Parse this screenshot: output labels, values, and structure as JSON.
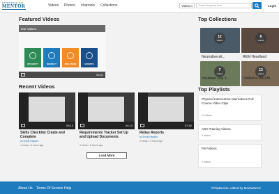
{
  "header": {
    "logo_small": "EXPERIENCE THE",
    "logo_main": "MENTOR",
    "nav": [
      "Videos",
      "Photos",
      "channels",
      "Collections"
    ],
    "scope_select": "Videos",
    "search_placeholder": "Search keyword here",
    "login": "Login"
  },
  "featured": {
    "heading": "Featured Videos",
    "title": "Our Values",
    "tiles": [
      {
        "label": "INTEGRITY",
        "color": "#2e8b57"
      },
      {
        "label": "RESPECT",
        "color": "#1e7bbd"
      },
      {
        "label": "INCLUSION",
        "color": "#f28c28"
      },
      {
        "label": "GROWTH",
        "color": "#1b4f8a"
      }
    ],
    "duration": "03:52"
  },
  "recent": {
    "heading": "Recent Videos",
    "videos": [
      {
        "title": "Skills Checklist Create and Complete",
        "author": "by Emily Heyden",
        "meta": "4 views • 8 hours ago",
        "duration": "03:13"
      },
      {
        "title": "Requirements Tracker Set Up and Upload Documents",
        "author": "by Emily Heyden",
        "meta": "3 views • 8 hours ago",
        "duration": "04:13"
      },
      {
        "title": "Relias Reports",
        "author": "by Emily Heyden",
        "meta": "2 views • 9 hours ago",
        "duration": "07:42"
      }
    ],
    "load_more": "Load More"
  },
  "collections": {
    "heading": "Top Collections",
    "items": [
      {
        "name": "Neurodiversit...",
        "count": "12",
        "unit": "videos"
      },
      {
        "name": "REM Heartland",
        "count": "6",
        "unit": "videos"
      },
      {
        "name": "Volunteer Day 2...",
        "count": "7",
        "unit": "videos"
      },
      {
        "name": "California MIE&M...",
        "count": "13",
        "unit": "videos"
      }
    ]
  },
  "playlists": {
    "heading": "Top Playlists",
    "items": [
      {
        "title": "Physical Intervention Alternatives Full Course Video Clips",
        "count": "14 videos"
      },
      {
        "title": "ADH Training Videos",
        "count": "3 videos"
      },
      {
        "title": "PM Videos",
        "count": "2 videos"
      }
    ]
  },
  "footer": {
    "links": [
      "About Us",
      "Terms Of Service",
      "Help"
    ],
    "copyright": "©ClipBucket, edited by MainWarrior"
  },
  "colors": {
    "accent": "#1e7bbd",
    "footer": "#1e7bbd"
  }
}
